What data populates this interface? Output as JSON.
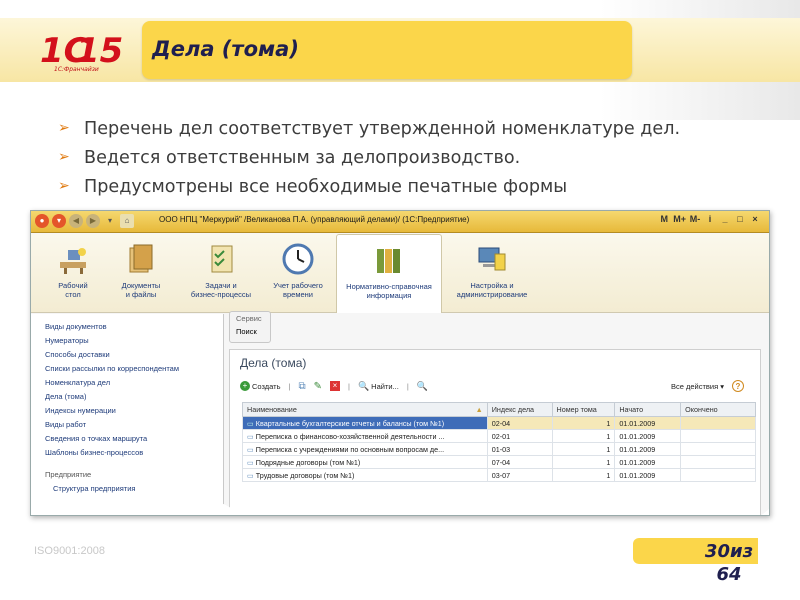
{
  "slide": {
    "title": "Дела (тома)",
    "logo_main": "1С",
    "logo_number": "15",
    "logo_sub": "1С:Франчайзи",
    "bullets": [
      "Перечень дел соответствует утвержденной номенклатуре дел.",
      "Ведется ответственным за делопроизводство.",
      "Предусмотрены все необходимые печатные формы"
    ],
    "footer_iso": "ISO9001:2008",
    "page_current": "30",
    "page_separator": "из",
    "page_total": "64"
  },
  "app": {
    "window_title": "ООО НПЦ \"Меркурий\" /Великанова П.А. (управляющий делами)/ (1С:Предприятие)",
    "title_buttons": [
      "M",
      "M+",
      "M-",
      "i",
      "_",
      "□",
      "×"
    ],
    "toolbar": [
      {
        "label1": "Рабочий",
        "label2": "стол",
        "icon": "desk-icon",
        "color": "#6b8fbf"
      },
      {
        "label1": "Документы",
        "label2": "и файлы",
        "icon": "documents-icon",
        "color": "#d4a14a"
      },
      {
        "label1": "Задачи и",
        "label2": "бизнес-процессы",
        "icon": "tasks-icon",
        "color": "#d9b65c"
      },
      {
        "label1": "Учет рабочего",
        "label2": "времени",
        "icon": "clock-icon",
        "color": "#4f79b0"
      },
      {
        "label1": "Нормативно-справочная",
        "label2": "информация",
        "icon": "reference-books-icon",
        "color": "#7a9a3a"
      },
      {
        "label1": "Настройка и",
        "label2": "администрирование",
        "icon": "admin-computer-icon",
        "color": "#5a88b8"
      }
    ],
    "sidebar": {
      "items": [
        "Виды документов",
        "Нумераторы",
        "Способы доставки",
        "Списки рассылки по корреспондентам",
        "Номенклатура дел",
        "Дела (тома)",
        "Индексы нумерации",
        "Виды работ",
        "Сведения о точках маршрута",
        "Шаблоны бизнес-процессов"
      ],
      "section_header": "Предприятие",
      "sub_items": [
        "Структура предприятия"
      ]
    },
    "service": {
      "label": "Сервис",
      "search": "Поиск"
    },
    "content": {
      "title": "Дела (тома)",
      "create_label": "Создать",
      "find_label": "Найти...",
      "all_actions": "Все действия",
      "help": "?",
      "columns": [
        "Наименование",
        "Индекс дела",
        "Номер тома",
        "Начато",
        "Окончено"
      ],
      "rows": [
        {
          "name": "Квартальные бухгалтерские отчеты и балансы (том №1)",
          "index": "02-04",
          "volume": "1",
          "start": "01.01.2009",
          "end": ""
        },
        {
          "name": "Переписка о финансово-хозяйственной деятельности ...",
          "index": "02-01",
          "volume": "1",
          "start": "01.01.2009",
          "end": ""
        },
        {
          "name": "Переписка с учреждениями по основным вопросам де...",
          "index": "01-03",
          "volume": "1",
          "start": "01.01.2009",
          "end": ""
        },
        {
          "name": "Подрядные договоры (том №1)",
          "index": "07-04",
          "volume": "1",
          "start": "01.01.2009",
          "end": ""
        },
        {
          "name": "Трудовые договоры (том №1)",
          "index": "03-07",
          "volume": "1",
          "start": "01.01.2009",
          "end": ""
        }
      ]
    }
  }
}
